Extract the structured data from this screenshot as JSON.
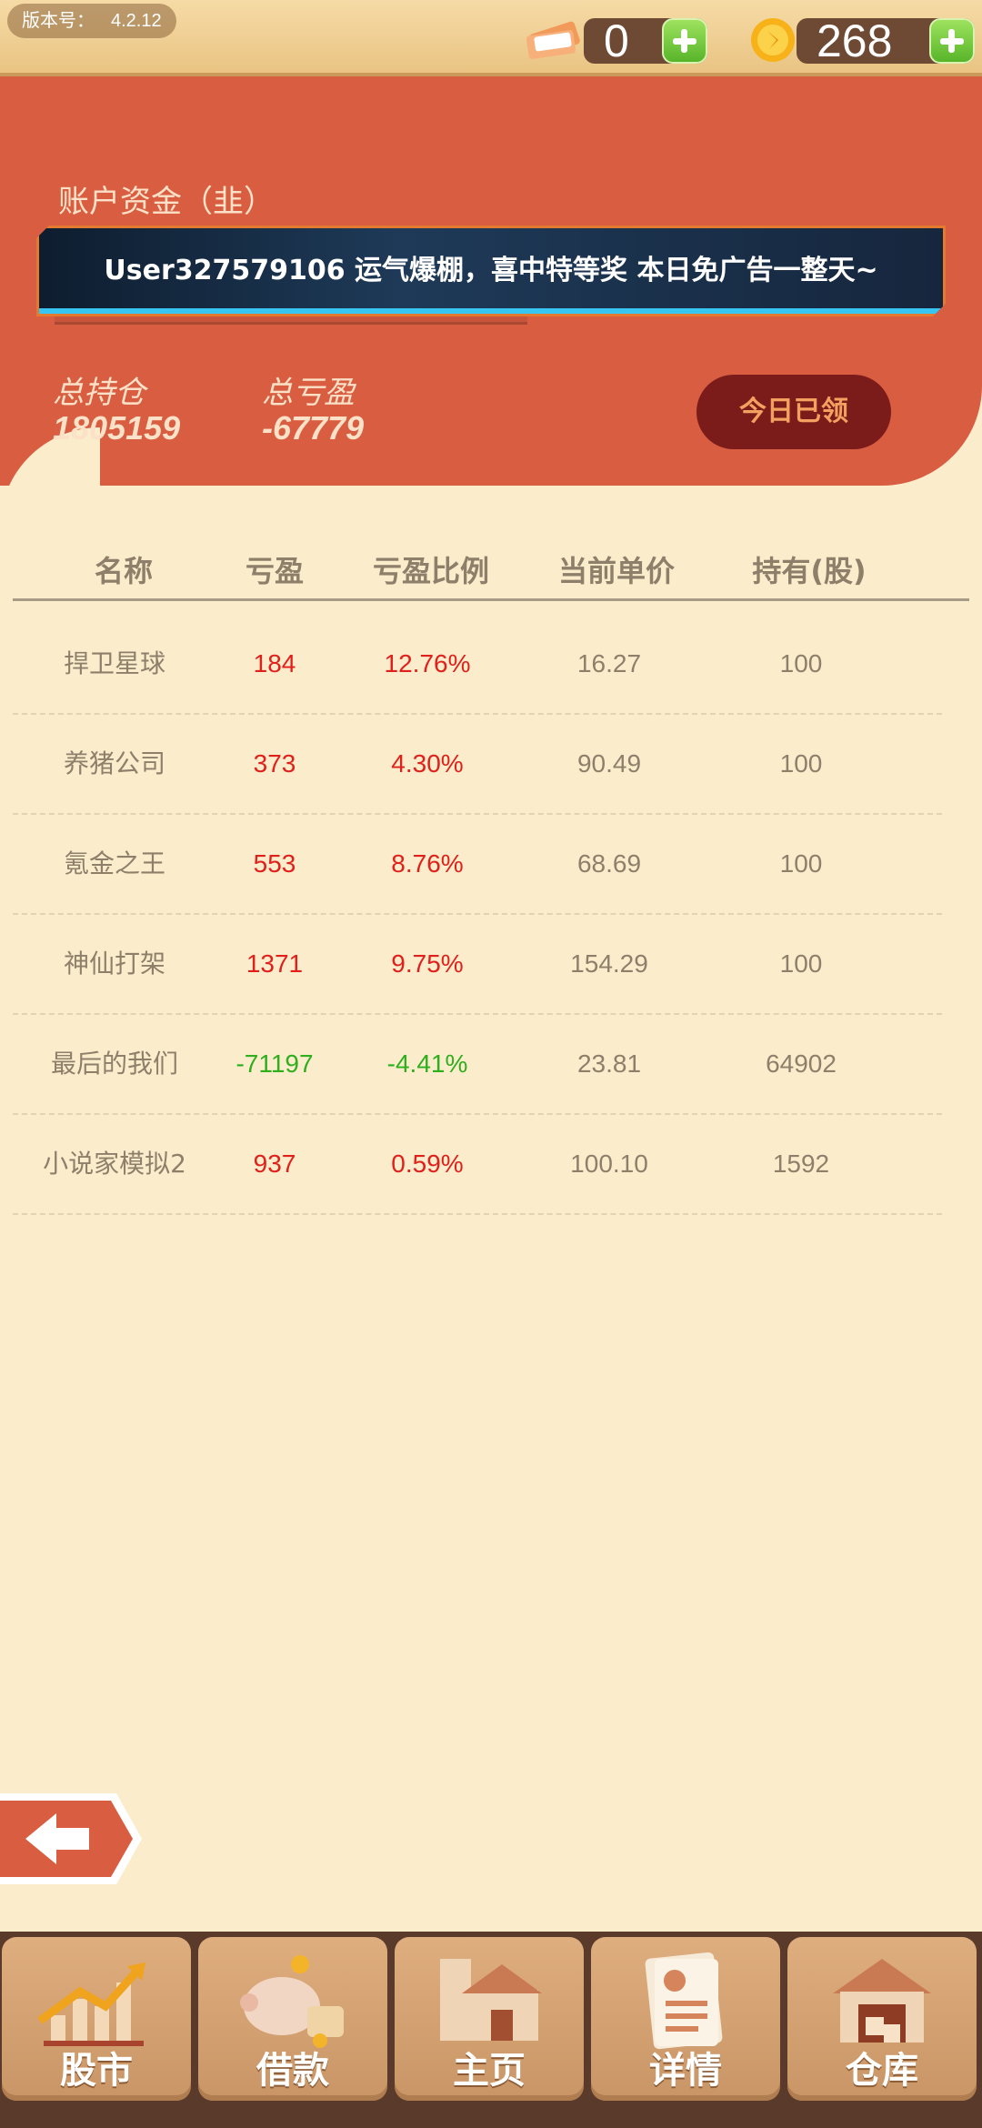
{
  "topbar": {
    "version_label": "版本号：",
    "version_number": "4.2.12",
    "tickets": "0",
    "coins": "268"
  },
  "account": {
    "label": "账户资金（韭）",
    "ticker": "User327579106 运气爆棚，喜中特等奖 本日免广告一整天~",
    "total_holdings_label": "总持仓",
    "total_holdings_value": "1805159",
    "total_pnl_label": "总亏盈",
    "total_pnl_value": "-67779",
    "claim_button": "今日已领"
  },
  "table": {
    "headers": [
      "名称",
      "亏盈",
      "亏盈比例",
      "当前单价",
      "持有(股)"
    ],
    "rows": [
      {
        "name": "捍卫星球",
        "pnl": "184",
        "ratio": "12.76%",
        "price": "16.27",
        "shares": "100",
        "trend": "pos"
      },
      {
        "name": "养猪公司",
        "pnl": "373",
        "ratio": "4.30%",
        "price": "90.49",
        "shares": "100",
        "trend": "pos"
      },
      {
        "name": "氪金之王",
        "pnl": "553",
        "ratio": "8.76%",
        "price": "68.69",
        "shares": "100",
        "trend": "pos"
      },
      {
        "name": "神仙打架",
        "pnl": "1371",
        "ratio": "9.75%",
        "price": "154.29",
        "shares": "100",
        "trend": "pos"
      },
      {
        "name": "最后的我们",
        "pnl": "-71197",
        "ratio": "-4.41%",
        "price": "23.81",
        "shares": "64902",
        "trend": "neg"
      },
      {
        "name": "小说家模拟2",
        "pnl": "937",
        "ratio": "0.59%",
        "price": "100.10",
        "shares": "1592",
        "trend": "pos"
      }
    ]
  },
  "nav": {
    "items": [
      {
        "label": "股市",
        "icon": "stock-chart-icon"
      },
      {
        "label": "借款",
        "icon": "piggy-bank-icon"
      },
      {
        "label": "主页",
        "icon": "home-building-icon"
      },
      {
        "label": "详情",
        "icon": "profile-card-icon"
      },
      {
        "label": "仓库",
        "icon": "warehouse-icon"
      }
    ]
  },
  "colors": {
    "panel": "#d95d41",
    "background": "#fbeccc",
    "positive": "#e0201b",
    "negative": "#2fae1e"
  }
}
